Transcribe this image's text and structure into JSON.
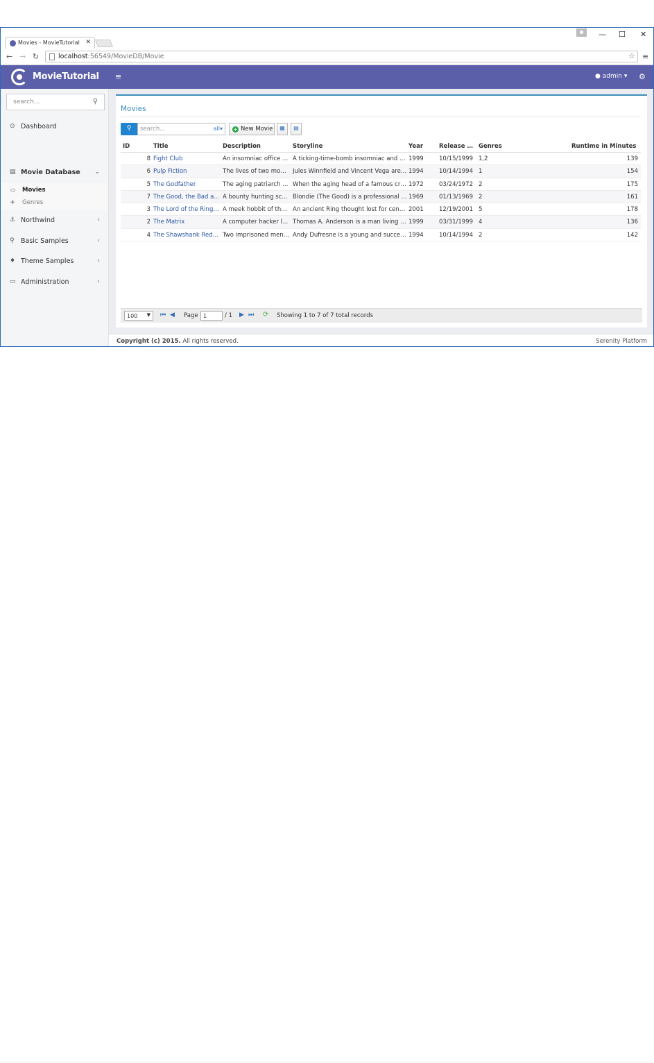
{
  "browser": {
    "tab_title": "Movies - MovieTutorial",
    "tab_close": "✕",
    "url_host": "localhost",
    "url_path": ":56549/MovieDB/Movie",
    "back": "←",
    "forward": "→",
    "reload": "↻",
    "minimize": "—",
    "maximize": "☐",
    "close": "✕",
    "star": "☆",
    "menu": "≡"
  },
  "header": {
    "brand": "MovieTutorial",
    "toggle": "≡",
    "user": "admin",
    "settings": "⚙"
  },
  "sidebar": {
    "search_placeholder": "search...",
    "items": [
      {
        "label": "Dashboard",
        "icon": "⊙",
        "chevron": ""
      },
      {
        "label": "Movie Database",
        "icon": "▤",
        "chevron": "⌄"
      },
      {
        "label": "Northwind",
        "icon": "⚓",
        "chevron": "‹"
      },
      {
        "label": "Basic Samples",
        "icon": "⚲",
        "chevron": "‹"
      },
      {
        "label": "Theme Samples",
        "icon": "♦",
        "chevron": "‹"
      },
      {
        "label": "Administration",
        "icon": "▭",
        "chevron": "‹"
      }
    ],
    "sub_items": [
      {
        "label": "Movies",
        "icon": "▭"
      },
      {
        "label": "Genres",
        "icon": "✈"
      }
    ]
  },
  "main": {
    "title": "Movies",
    "quick_search_placeholder": "search...",
    "quick_search_field": "all",
    "new_button": "New Movie",
    "columns": [
      "ID",
      "Title",
      "Description",
      "Storyline",
      "Year",
      "Release Da...",
      "Genres",
      "Runtime in Minutes"
    ],
    "rows": [
      {
        "id": "8",
        "title": "Fight Club",
        "desc": "An insomniac office w...",
        "story": "A ticking-time-bomb insomniac and a s...",
        "year": "1999",
        "release": "10/15/1999",
        "genres": "1,2",
        "runtime": "139"
      },
      {
        "id": "6",
        "title": "Pulp Fiction",
        "desc": "The lives of two mob ...",
        "story": "Jules Winnfield and Vincent Vega are t...",
        "year": "1994",
        "release": "10/14/1994",
        "genres": "1",
        "runtime": "154"
      },
      {
        "id": "5",
        "title": "The Godfather",
        "desc": "The aging patriarch of...",
        "story": "When the aging head of a famous crim...",
        "year": "1972",
        "release": "03/24/1972",
        "genres": "2",
        "runtime": "175"
      },
      {
        "id": "7",
        "title": "The Good, the Bad an...",
        "desc": "A bounty hunting sca...",
        "story": "Blondie (The Good) is a professional g...",
        "year": "1969",
        "release": "01/13/1969",
        "genres": "2",
        "runtime": "161"
      },
      {
        "id": "3",
        "title": "The Lord of the Rings:...",
        "desc": "A meek hobbit of the ...",
        "story": "An ancient Ring thought lost for centu...",
        "year": "2001",
        "release": "12/19/2001",
        "genres": "5",
        "runtime": "178"
      },
      {
        "id": "2",
        "title": "The Matrix",
        "desc": "A computer hacker le...",
        "story": "Thomas A. Anderson is a man living tw...",
        "year": "1999",
        "release": "03/31/1999",
        "genres": "4",
        "runtime": "136"
      },
      {
        "id": "4",
        "title": "The Shawshank Rede...",
        "desc": "Two imprisoned men ...",
        "story": "Andy Dufresne is a young and success...",
        "year": "1994",
        "release": "10/14/1994",
        "genres": "2",
        "runtime": "142"
      }
    ],
    "pager": {
      "page_size": "100",
      "page_label": "Page",
      "page_value": "1",
      "page_total": "/ 1",
      "status": "Showing 1 to 7 of 7 total records"
    }
  },
  "footer": {
    "copyright_bold": "Copyright (c) 2015.",
    "copyright_rest": " All rights reserved.",
    "platform": "Serenity Platform"
  },
  "colors": {
    "header": "#5b5ea8",
    "accent": "#3c8dbc",
    "link": "#2a55a3"
  }
}
